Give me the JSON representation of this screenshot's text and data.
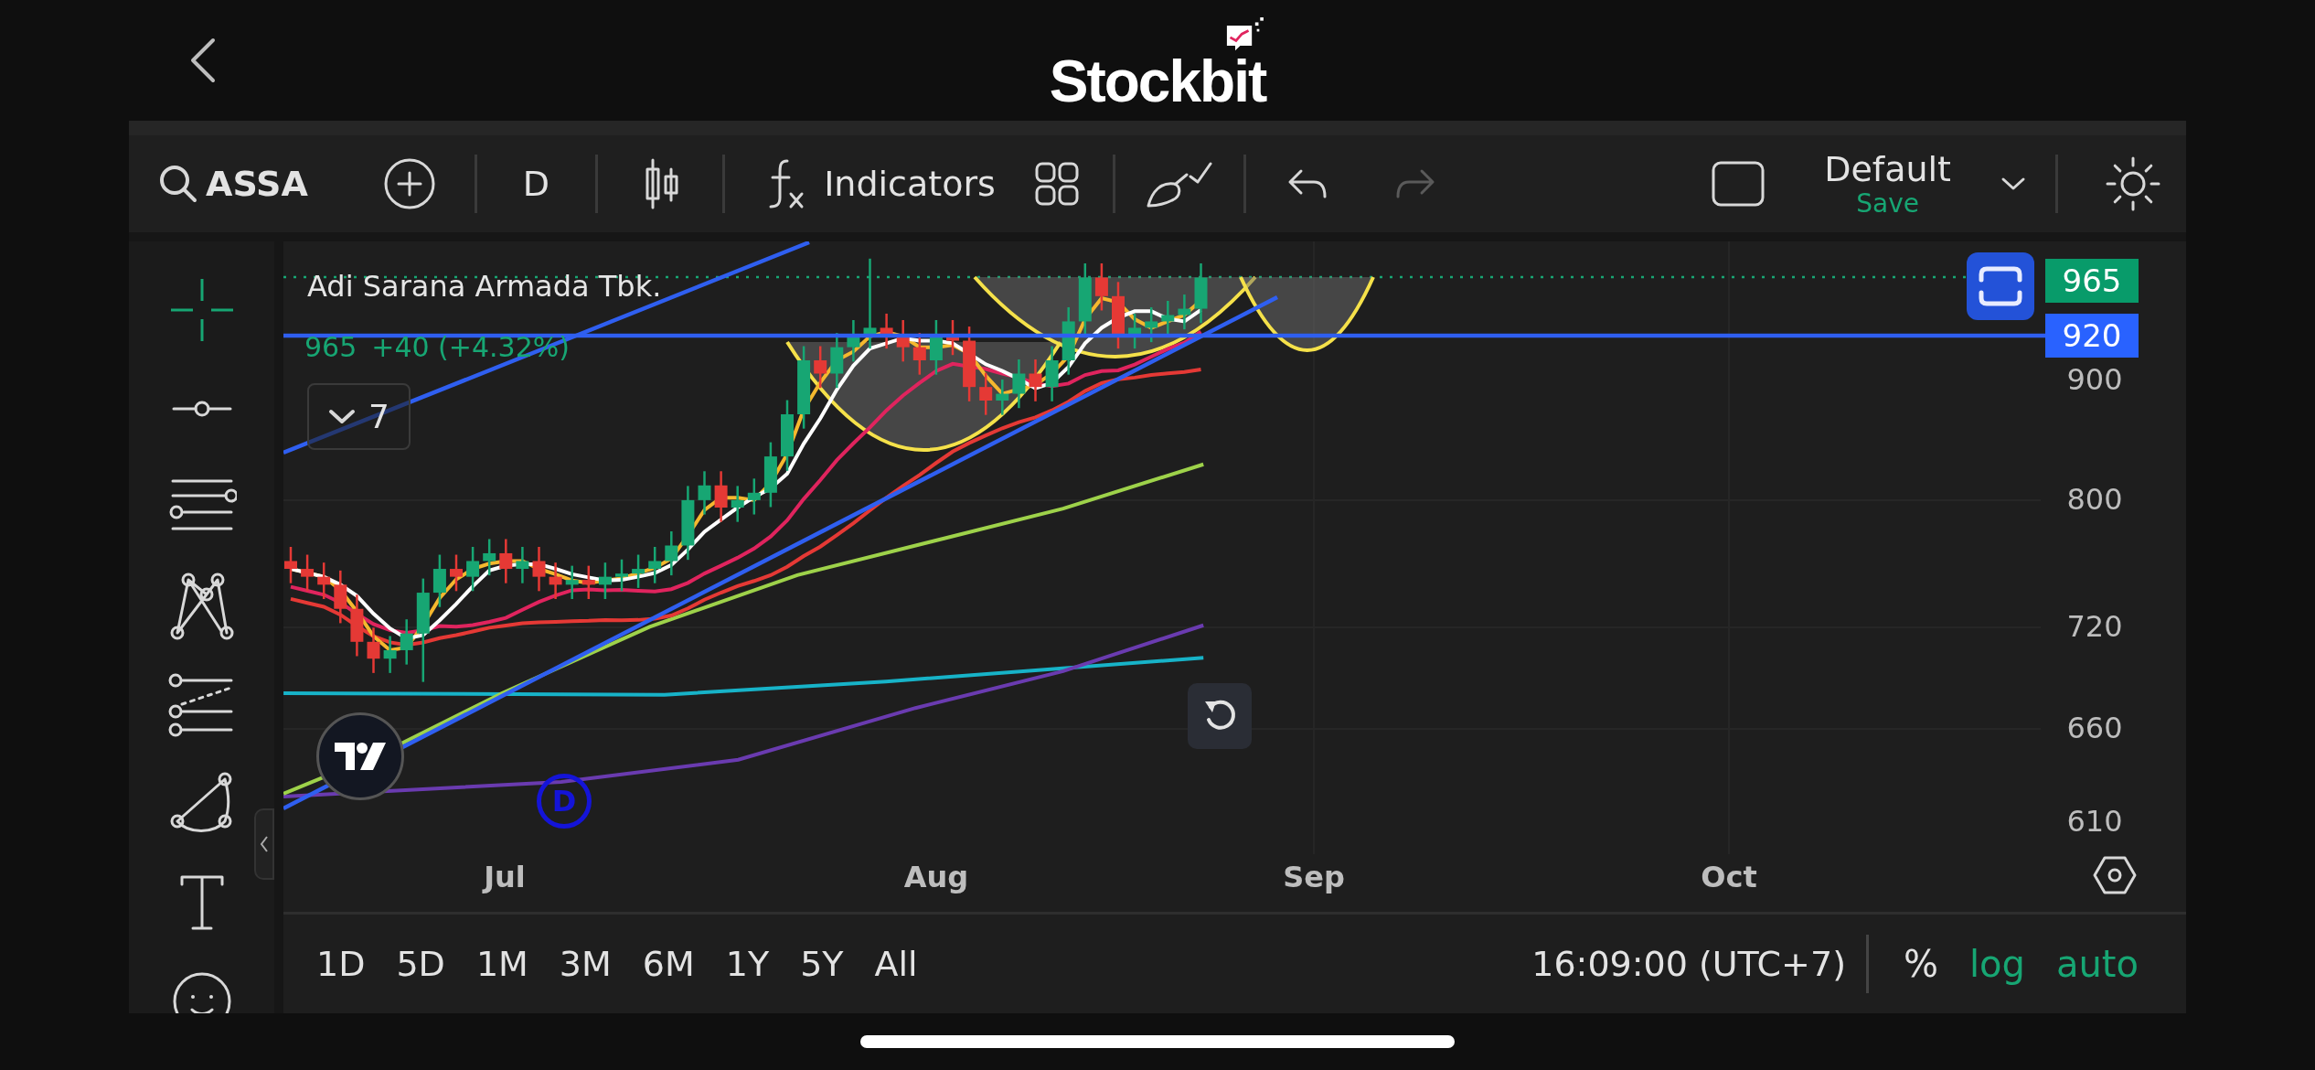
{
  "header": {
    "logo_text": "Stockbit"
  },
  "toolbar": {
    "symbol": "ASSA",
    "interval": "D",
    "indicators_label": "Indicators",
    "undo": {
      "disabled": false
    },
    "redo": {
      "disabled": true
    },
    "layout": {
      "name": "Default",
      "action": "Save"
    }
  },
  "chart": {
    "title": "Adi Sarana Armada Tbk.",
    "price": "965",
    "change": "+40 (+4.32%)",
    "legend_count": "7",
    "marker": "D",
    "price_tags": [
      {
        "label": "965",
        "color": "#089b6a"
      },
      {
        "label": "920",
        "color": "#2962ff"
      }
    ],
    "y_axis": [
      "900",
      "800",
      "720",
      "660",
      "610"
    ],
    "x_axis": [
      "Jul",
      "Aug",
      "Sep",
      "Oct"
    ]
  },
  "ranges": [
    "1D",
    "5D",
    "1M",
    "3M",
    "6M",
    "1Y",
    "5Y",
    "All"
  ],
  "time": "16:09:00 (UTC+7)",
  "scale_options": [
    {
      "label": "%",
      "on": false
    },
    {
      "label": "log",
      "on": true
    },
    {
      "label": "auto",
      "on": true
    }
  ]
}
